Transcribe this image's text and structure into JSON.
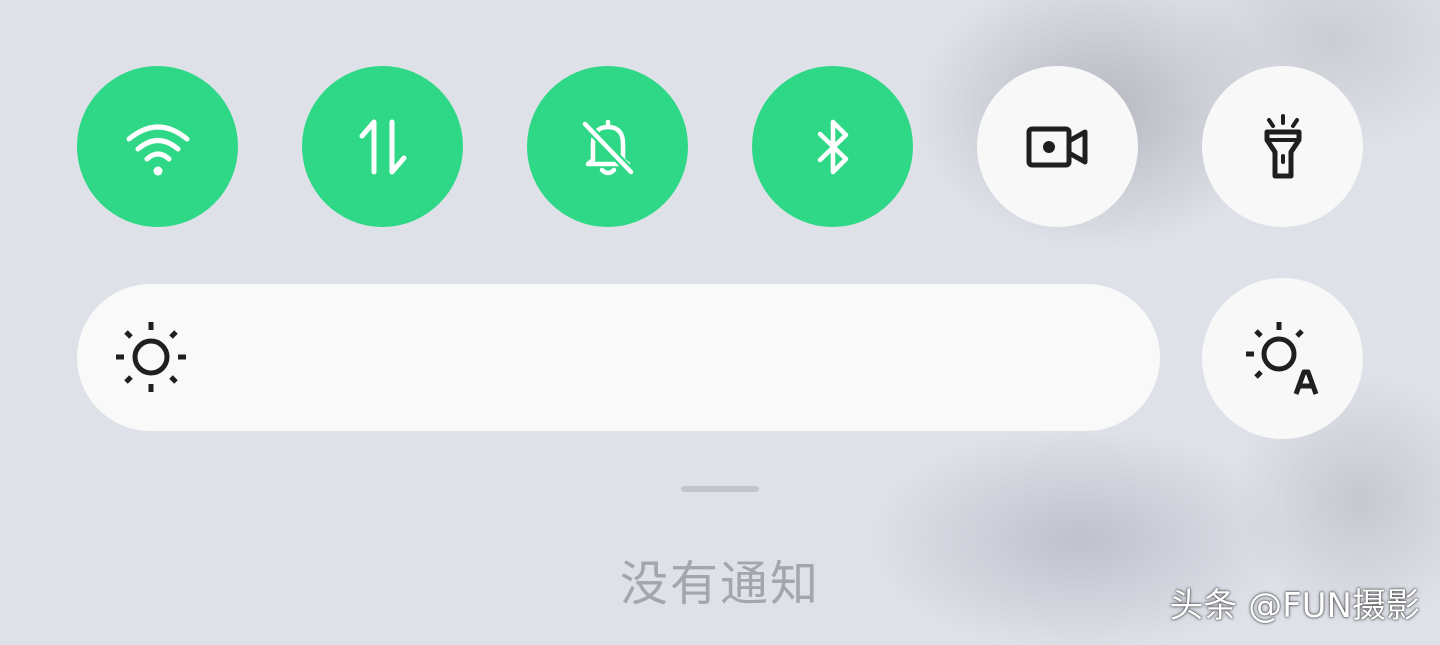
{
  "quick_settings": {
    "tiles": [
      {
        "id": "wifi",
        "state": "on",
        "icon": "wifi-icon"
      },
      {
        "id": "mobile-data",
        "state": "on",
        "icon": "mobile-data-arrows-icon"
      },
      {
        "id": "silent",
        "state": "on",
        "icon": "bell-off-icon"
      },
      {
        "id": "bluetooth",
        "state": "on",
        "icon": "bluetooth-icon"
      },
      {
        "id": "screen-record",
        "state": "off",
        "icon": "screen-record-icon"
      },
      {
        "id": "flashlight",
        "state": "off",
        "icon": "flashlight-icon"
      }
    ],
    "brightness": {
      "icon": "sun-icon",
      "auto_icon": "auto-brightness-icon"
    }
  },
  "notifications": {
    "empty_text": "没有通知"
  },
  "watermark": {
    "text": "头条 @FUN摄影"
  },
  "colors": {
    "active_tile": "#2fd886",
    "inactive_tile": "#f8f8f9",
    "background": "#dee1e8",
    "icon_dark": "#1f1f1f",
    "icon_light": "#ffffff"
  }
}
